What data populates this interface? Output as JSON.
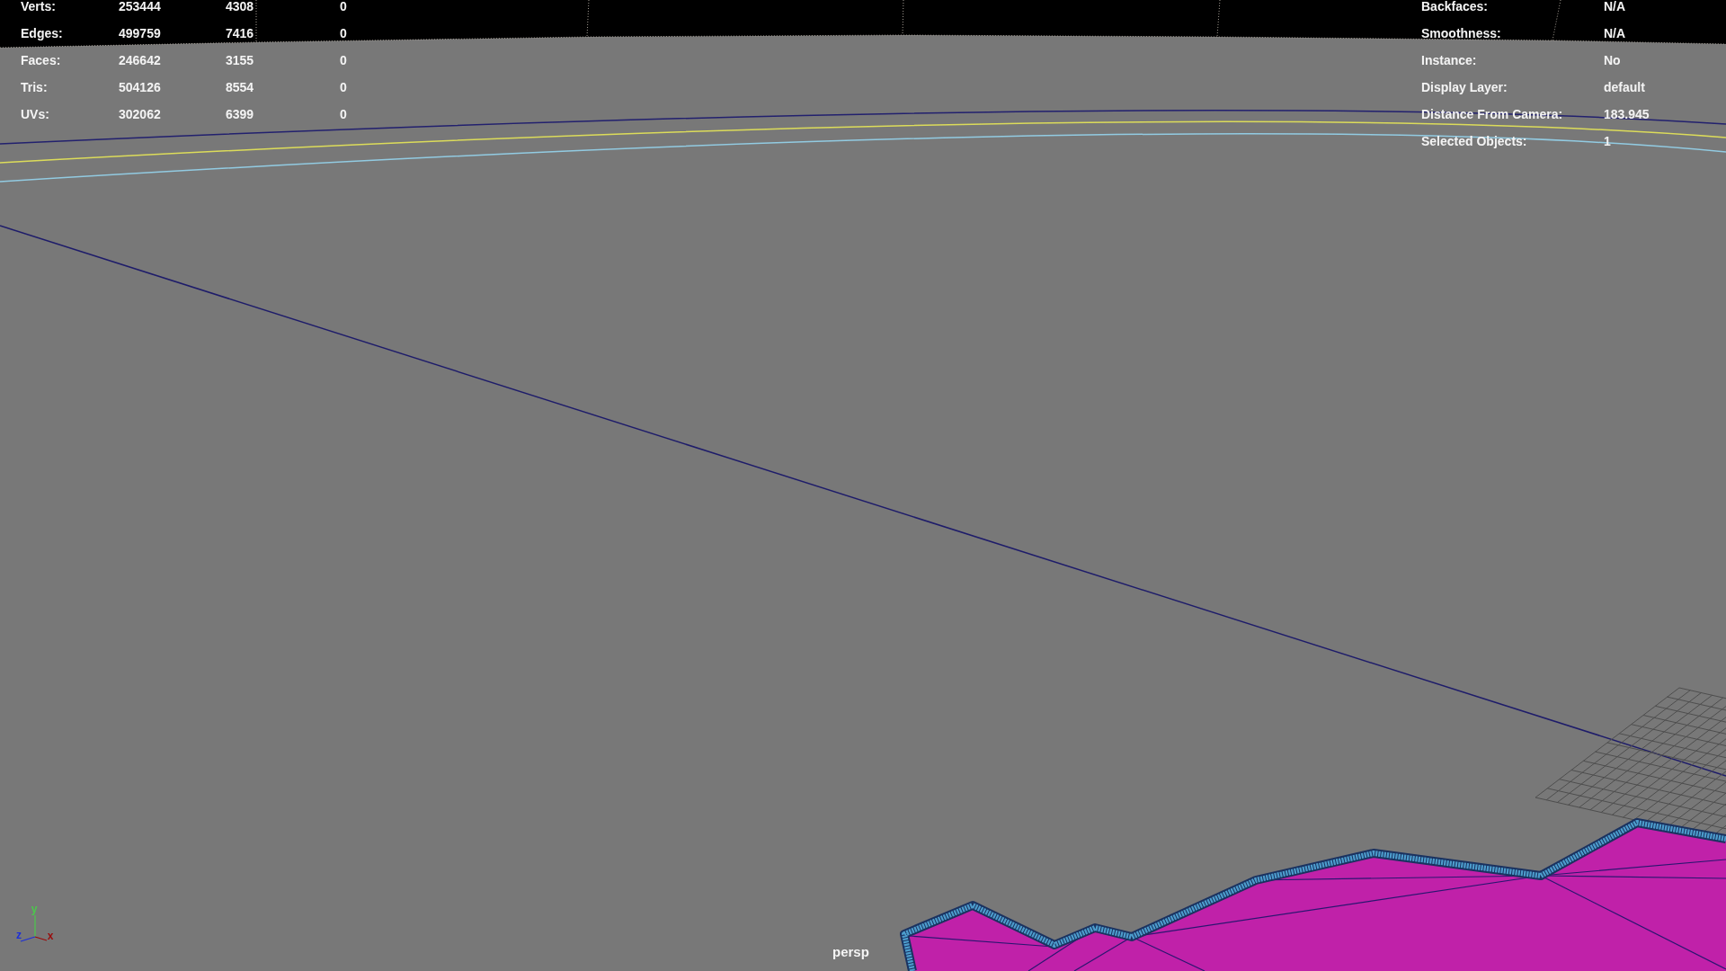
{
  "hud_left": {
    "rows": [
      {
        "label": "Verts:",
        "values": [
          "253444",
          "4308",
          "0"
        ]
      },
      {
        "label": "Edges:",
        "values": [
          "499759",
          "7416",
          "0"
        ]
      },
      {
        "label": "Faces:",
        "values": [
          "246642",
          "3155",
          "0"
        ]
      },
      {
        "label": "Tris:",
        "values": [
          "504126",
          "8554",
          "0"
        ]
      },
      {
        "label": "UVs:",
        "values": [
          "302062",
          "6399",
          "0"
        ]
      }
    ]
  },
  "hud_right": {
    "rows": [
      {
        "label": "Backfaces:",
        "value": "N/A"
      },
      {
        "label": "Smoothness:",
        "value": "N/A"
      },
      {
        "label": "Instance:",
        "value": "No"
      },
      {
        "label": "Display Layer:",
        "value": "default"
      },
      {
        "label": "Distance From Camera:",
        "value": "183.945"
      },
      {
        "label": "Selected Objects:",
        "value": "1"
      }
    ]
  },
  "axis_gizmo": {
    "axes": [
      {
        "label": "y",
        "color": "#4cc84c"
      },
      {
        "label": "z",
        "color": "#1c2ed8"
      },
      {
        "label": "x",
        "color": "#9a0c0c"
      }
    ]
  },
  "camera_label": "persp"
}
